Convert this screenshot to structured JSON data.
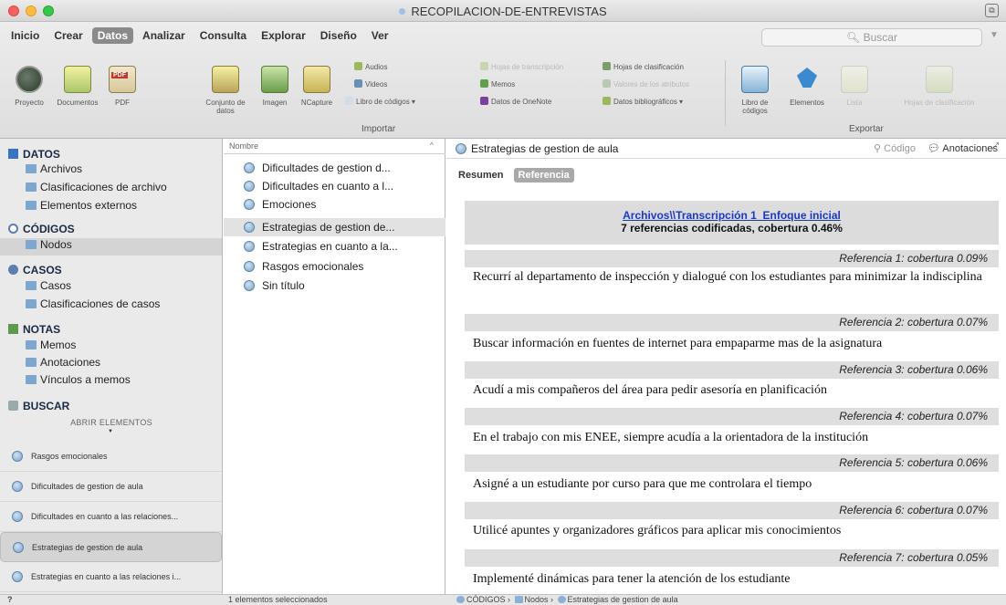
{
  "window": {
    "title": "RECOPILACION-DE-ENTREVISTAS"
  },
  "menu": {
    "tabs": [
      {
        "label": "Inicio"
      },
      {
        "label": "Crear"
      },
      {
        "label": "Datos"
      },
      {
        "label": "Analizar"
      },
      {
        "label": "Consulta"
      },
      {
        "label": "Explorar"
      },
      {
        "label": "Diseño"
      },
      {
        "label": "Ver"
      }
    ],
    "active": "Datos"
  },
  "search": {
    "placeholder": "Buscar"
  },
  "ribbon": {
    "buttons": {
      "proyecto": "Proyecto",
      "documentos": "Documentos",
      "pdf": "PDF",
      "conjunto": "Conjunto de datos",
      "imagen": "Imagen",
      "ncapture": "NCapture"
    },
    "small": {
      "audios": "Audios",
      "videos": "Videos",
      "libro_codigos": "Libro de códigos ▾",
      "hojas_transcripcion": "Hojas de transcripción",
      "memos": "Memos",
      "onenote": "Datos de OneNote",
      "hojas_clasificacion": "Hojas de clasificación",
      "valores_atributos": "Valores de los atributos",
      "datos_bibliograficos": "Datos bibliográficos ▾"
    },
    "export_buttons": {
      "libro_codigos": "Libro de códigos",
      "elementos": "Elementos",
      "lista": "Lista",
      "hojas_clasificacion": "Hojas de clasificación"
    },
    "groups": {
      "importar": "Importar",
      "exportar": "Exportar"
    }
  },
  "nav": {
    "datos": {
      "title": "DATOS",
      "items": [
        "Archivos",
        "Clasificaciones de archivo",
        "Elementos externos"
      ]
    },
    "codigos": {
      "title": "CÓDIGOS",
      "items": [
        "Nodos"
      ]
    },
    "casos": {
      "title": "CASOS",
      "items": [
        "Casos",
        "Clasificaciones de casos"
      ]
    },
    "notas": {
      "title": "NOTAS",
      "items": [
        "Memos",
        "Anotaciones",
        "Vínculos a memos"
      ]
    },
    "buscar": {
      "title": "BUSCAR"
    },
    "abrir_label": "ABRIR ELEMENTOS",
    "open_items": [
      "Rasgos emocionales",
      "Dificultades de gestion de aula",
      "Dificultades en cuanto a las relaciones...",
      "Estrategias de gestion de aula",
      "Estrategias en cuanto a las relaciones i..."
    ]
  },
  "list": {
    "column": "Nombre",
    "items": [
      "Dificultades de gestion d...",
      "Dificultades en cuanto a l...",
      "Emociones",
      "Estrategias de gestion de...",
      "Estrategias en cuanto a la...",
      "Rasgos emocionales",
      "Sin título"
    ],
    "selected_index": 3
  },
  "detail": {
    "title": "Estrategias de gestion de aula",
    "codigo": "Código",
    "anotaciones": "Anotaciones",
    "tabs": {
      "resumen": "Resumen",
      "referencia": "Referencia"
    },
    "source_link": "Archivos\\\\Transcripción 1_Enfoque inicial",
    "summary": "7 referencias codificadas, cobertura 0.46%",
    "references": [
      {
        "label": "Referencia 1: cobertura 0.09%",
        "text": "Recurrí al departamento de inspección y dialogué con los estudiantes para minimizar la indisciplina"
      },
      {
        "label": "Referencia 2: cobertura 0.07%",
        "text": "Buscar información en fuentes de internet para empaparme mas de la asignatura"
      },
      {
        "label": "Referencia 3: cobertura 0.06%",
        "text": "Acudí a mis compañeros del área para pedir asesoría en planificación"
      },
      {
        "label": "Referencia 4: cobertura 0.07%",
        "text": "En el trabajo con mis ENEE, siempre acudía a la orientadora de la institución"
      },
      {
        "label": "Referencia 5: cobertura 0.06%",
        "text": "Asigné a un estudiante por curso para que me controlara el tiempo"
      },
      {
        "label": "Referencia 6: cobertura 0.07%",
        "text": "Utilicé apuntes y organizadores gráficos para aplicar mis conocimientos"
      },
      {
        "label": "Referencia 7: cobertura 0.05%",
        "text": "Implementé dinámicas para tener la atención de los estudiante"
      }
    ]
  },
  "status": {
    "selected": "1 elementos seleccionados",
    "crumb": [
      "CÓDIGOS",
      "Nodos",
      "Estrategias de gestion de aula"
    ]
  }
}
